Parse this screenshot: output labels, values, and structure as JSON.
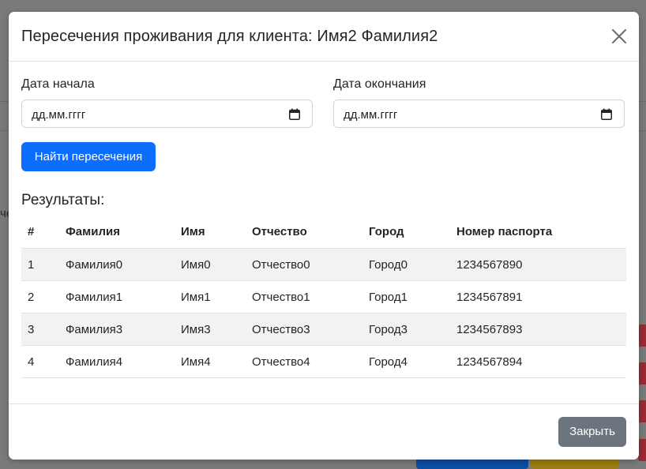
{
  "modal": {
    "title": "Пересечения проживания для клиента: Имя2 Фамилия2",
    "start_label": "Дата начала",
    "end_label": "Дата окончания",
    "start_value": "дд.мм.гггг",
    "end_value": "дд.мм.гггг",
    "find_button": "Найти пересечения",
    "results_title": "Результаты:",
    "close_button": "Закрыть"
  },
  "table": {
    "headers": [
      "#",
      "Фамилия",
      "Имя",
      "Отчество",
      "Город",
      "Номер паспорта"
    ],
    "rows": [
      [
        "1",
        "Фамилия0",
        "Имя0",
        "Отчество0",
        "Город0",
        "1234567890"
      ],
      [
        "2",
        "Фамилия1",
        "Имя1",
        "Отчество1",
        "Город1",
        "1234567891"
      ],
      [
        "3",
        "Фамилия3",
        "Имя3",
        "Отчество3",
        "Город3",
        "1234567893"
      ],
      [
        "4",
        "Фамилия4",
        "Имя4",
        "Отчество4",
        "Город4",
        "1234567894"
      ]
    ]
  },
  "background": {
    "edge_text": "че"
  },
  "colors": {
    "primary": "#0d6efd",
    "secondary": "#6c757d",
    "backdrop": "#7a7a7a"
  }
}
